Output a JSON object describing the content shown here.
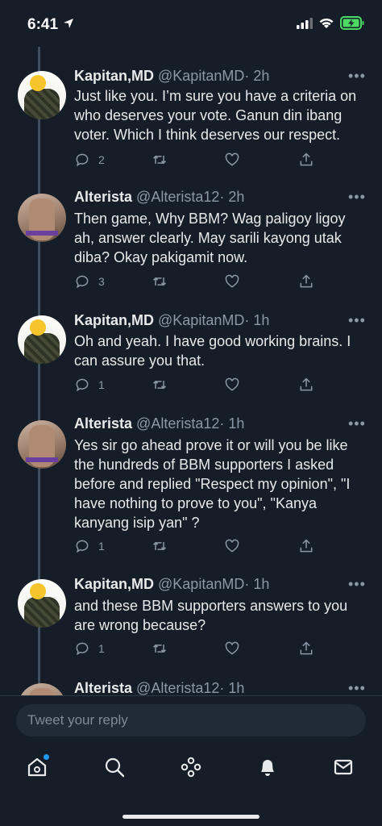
{
  "status_bar": {
    "time": "6:41"
  },
  "tweets": [
    {
      "name": "Kapitan,MD",
      "handle": "@KapitanMD",
      "time": "· 2h",
      "text": "Just like you. I’m sure you have a criteria on who deserves your vote. Ganun din ibang voter. Which I think deserves our respect.",
      "replies": "2"
    },
    {
      "name": "Alterista",
      "handle": "@Alterista12",
      "time": "· 2h",
      "text": "Then game, Why BBM? Wag paligoy ligoy ah, answer clearly. May sarili kayong utak diba? Okay pakigamit now.",
      "replies": "3"
    },
    {
      "name": "Kapitan,MD",
      "handle": "@KapitanMD",
      "time": "· 1h",
      "text": "Oh and yeah. I have good working brains. I can assure you that.",
      "replies": "1"
    },
    {
      "name": "Alterista",
      "handle": "@Alterista12",
      "time": "· 1h",
      "text": "Yes sir go ahead prove it or will you be like the hundreds of BBM supporters I asked before and replied \"Respect my opinion\", \"I have nothing to prove to you\", \"Kanya kanyang isip yan\" ?",
      "replies": "1"
    },
    {
      "name": "Kapitan,MD",
      "handle": "@KapitanMD",
      "time": "· 1h",
      "text": "and these BBM supporters answers to you are wrong because?",
      "replies": "1"
    },
    {
      "name": "Alterista",
      "handle": "@Alterista12",
      "time": "· 1h",
      "text": "",
      "replies": ""
    }
  ],
  "reply": {
    "placeholder": "Tweet your reply"
  },
  "more_label": "•••",
  "tabbar": [
    "home-icon",
    "search-icon",
    "spaces-icon",
    "notifications-icon",
    "messages-icon"
  ],
  "colors": {
    "background": "#151d28",
    "accent": "#1d9bf0",
    "muted": "#8b98a5"
  }
}
